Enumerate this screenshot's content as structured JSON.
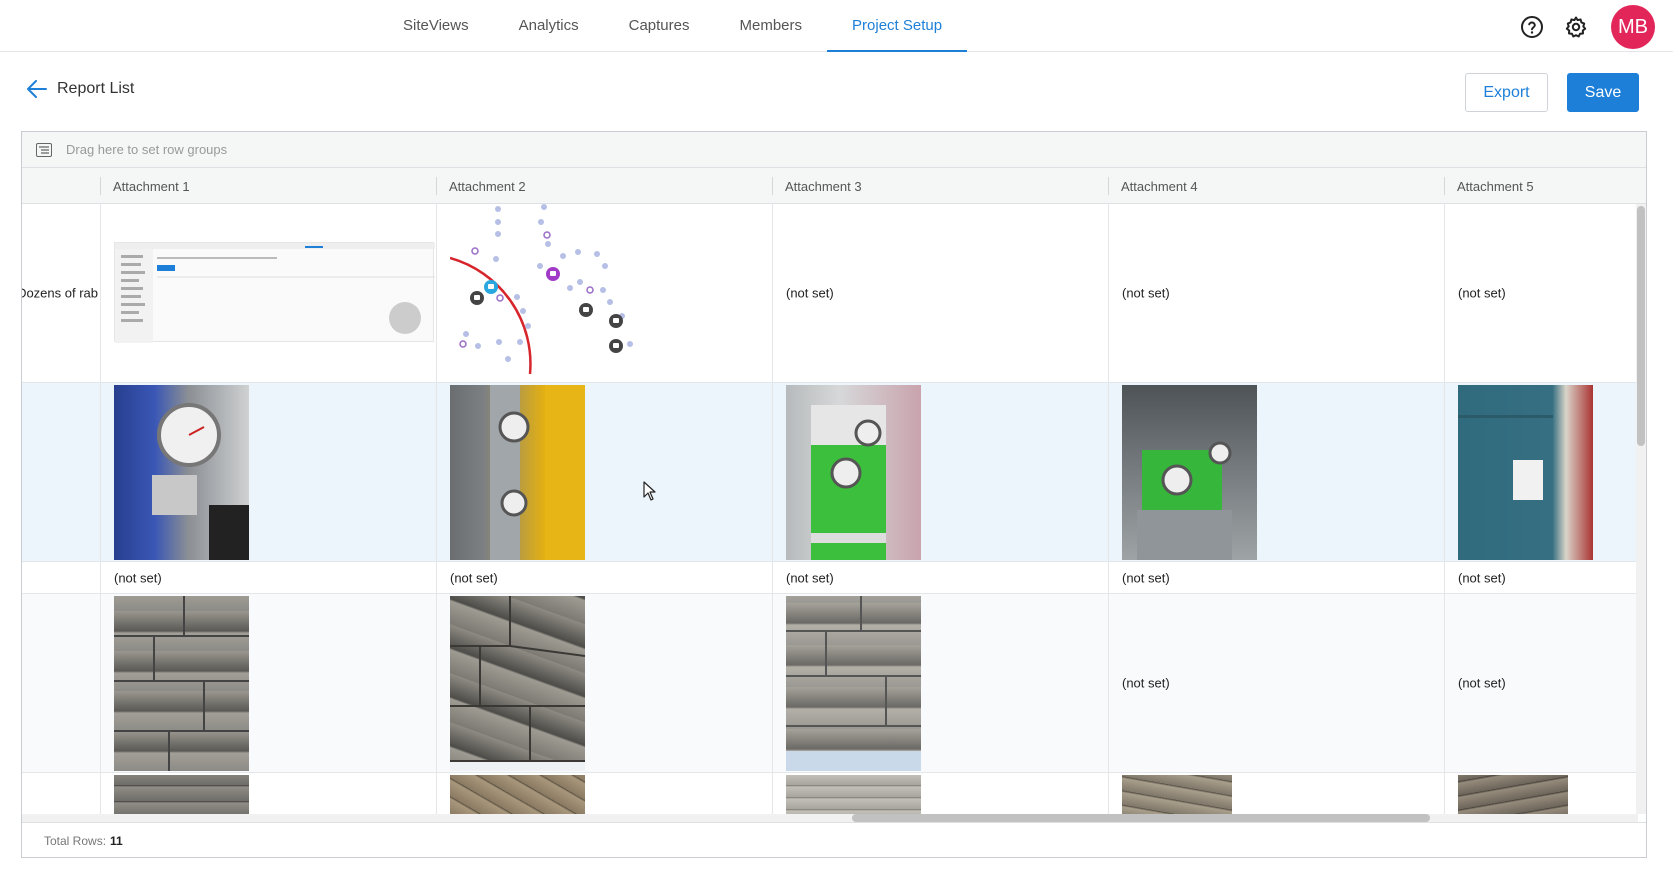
{
  "nav": {
    "tabs": [
      {
        "label": "SiteViews",
        "active": false
      },
      {
        "label": "Analytics",
        "active": false
      },
      {
        "label": "Captures",
        "active": false
      },
      {
        "label": "Members",
        "active": false
      },
      {
        "label": "Project Setup",
        "active": true
      }
    ],
    "help_icon": "help-circle-icon",
    "settings_icon": "gear-icon",
    "avatar_initials": "MB",
    "avatar_color": "#e2265a"
  },
  "header": {
    "back_label": "Report List",
    "export_label": "Export",
    "save_label": "Save",
    "accent_color": "#1e7fd8"
  },
  "grid": {
    "group_placeholder": "Drag here to set row groups",
    "columns": [
      "Attachment 1",
      "Attachment 2",
      "Attachment 3",
      "Attachment 4",
      "Attachment 5"
    ],
    "rows": [
      {
        "first": "Dozens of rab",
        "cells": [
          "[image: screenshot]",
          "[image: map]",
          "(not set)",
          "(not set)",
          "(not set)"
        ]
      },
      {
        "first": "",
        "cells": [
          "[image: gauge]",
          "[image: gauge]",
          "[image: gauge]",
          "[image: gauge]",
          "[image: panel]"
        ]
      },
      {
        "first": "",
        "cells": [
          "(not set)",
          "(not set)",
          "(not set)",
          "(not set)",
          "(not set)"
        ]
      },
      {
        "first": "",
        "cells": [
          "[image: stone]",
          "[image: stone]",
          "[image: stone]",
          "(not set)",
          "(not set)"
        ]
      },
      {
        "first": "",
        "cells": [
          "[image: stone]",
          "[image: stone]",
          "[image: stone]",
          "[image: stone]",
          "[image: stone]"
        ]
      }
    ],
    "not_set": "(not set)",
    "total_rows_label": "Total Rows:",
    "total_rows_value": "11"
  }
}
